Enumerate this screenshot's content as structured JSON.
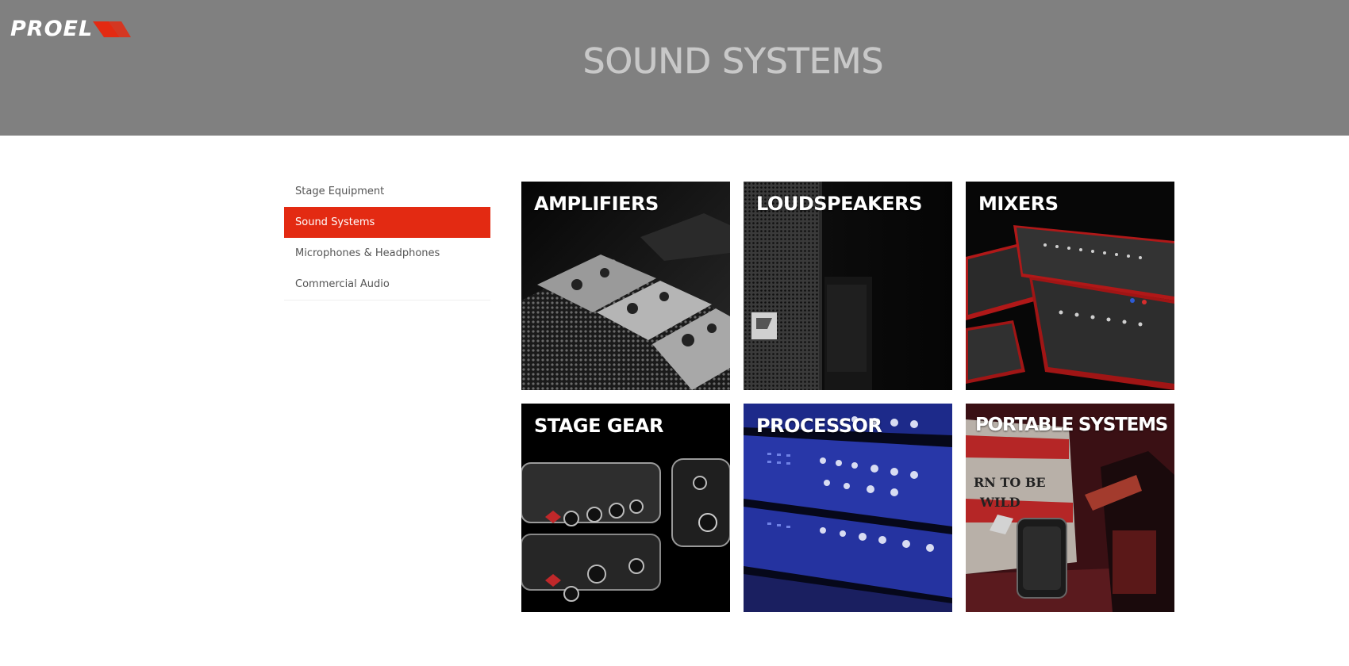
{
  "brand": {
    "logo_text": "PROEL",
    "logo_icon": "proel-chevron-icon",
    "accent_color": "#e32a12"
  },
  "header": {
    "title": "SOUND SYSTEMS",
    "background": "#808080"
  },
  "sidebar": {
    "items": [
      {
        "label": "Stage Equipment",
        "active": false
      },
      {
        "label": "Sound Systems",
        "active": true
      },
      {
        "label": "Microphones & Headphones",
        "active": false
      },
      {
        "label": "Commercial Audio",
        "active": false
      }
    ]
  },
  "categories": [
    {
      "label": "AMPLIFIERS"
    },
    {
      "label": "LOUDSPEAKERS"
    },
    {
      "label": "MIXERS"
    },
    {
      "label": "STAGE GEAR"
    },
    {
      "label": "PROCESSOR"
    },
    {
      "label": "PORTABLE SYSTEMS"
    }
  ]
}
